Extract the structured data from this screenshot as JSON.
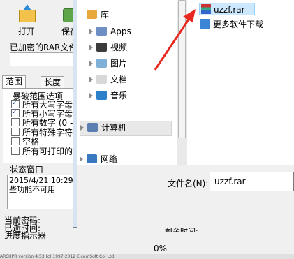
{
  "app": {
    "toolbar": {
      "open": "打开",
      "save": "保存"
    },
    "encrypted_label": "已加密的RAR文件",
    "tabs": [
      "范围",
      "长度"
    ],
    "range_title": "暴破范围选项",
    "options": [
      {
        "label": "所有大写字母",
        "checked": true
      },
      {
        "label": "所有小写字母",
        "checked": true
      },
      {
        "label": "所有数字 (0 -",
        "checked": false
      },
      {
        "label": "所有特殊字符",
        "checked": false
      },
      {
        "label": "空格",
        "checked": false
      },
      {
        "label": "所有可打印的字",
        "checked": false
      }
    ],
    "status_title": "状态窗口",
    "status_lines": [
      "2015/4/21 10:29",
      "些功能不可用"
    ],
    "current_password": "当前密码:",
    "elapsed": "已逝时间:",
    "progress_label": "进度指示器",
    "remaining": "剩余时间:",
    "progress_value": "0%",
    "bottom_strip": "ARCHPR version 4.53 (c) 1997-2012 ElcomSoft Co. Ltd."
  },
  "dialog": {
    "nav": [
      {
        "label": "库",
        "icon": "library-icon"
      },
      {
        "label": "Apps",
        "icon": "apps-icon"
      },
      {
        "label": "视频",
        "icon": "video-icon"
      },
      {
        "label": "图片",
        "icon": "picture-icon"
      },
      {
        "label": "文档",
        "icon": "document-icon"
      },
      {
        "label": "音乐",
        "icon": "music-icon"
      },
      {
        "label": "计算机",
        "icon": "computer-icon"
      },
      {
        "label": "网络",
        "icon": "network-icon"
      }
    ],
    "files": [
      {
        "label": "uzzf.rar",
        "icon": "rar-icon",
        "selected": true
      },
      {
        "label": "更多软件下载",
        "icon": "shortcut-icon",
        "selected": false
      }
    ],
    "filename_label": "文件名(N):",
    "filename_value": "uzzf.rar"
  },
  "annotation": {
    "arrow_color": "#e8271f"
  }
}
